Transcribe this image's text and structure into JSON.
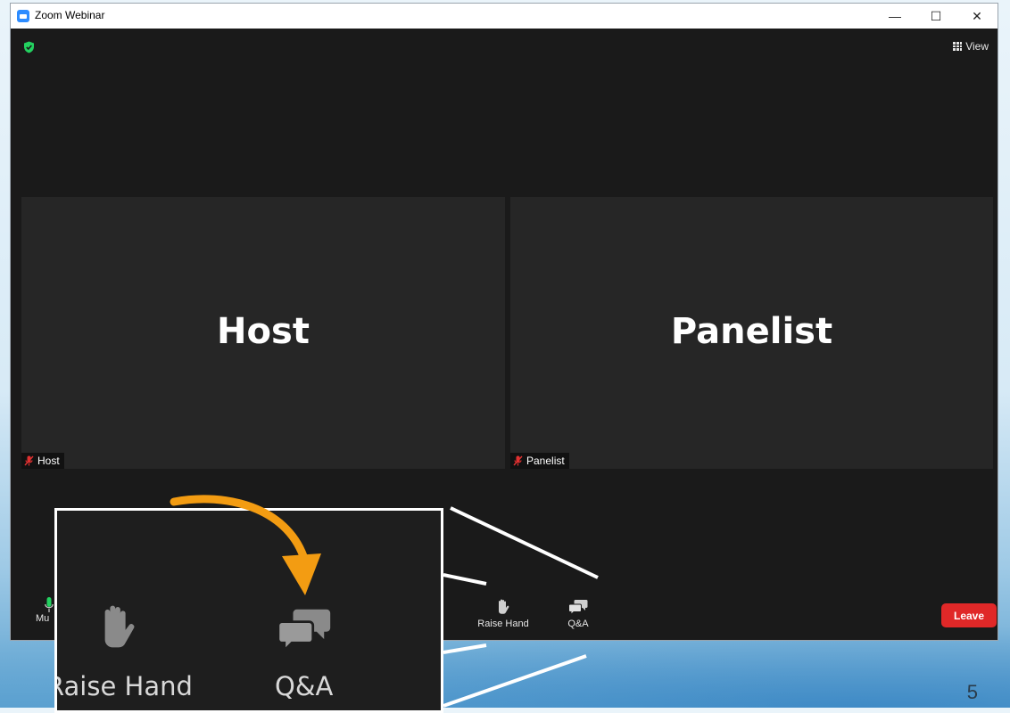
{
  "window": {
    "title": "Zoom Webinar",
    "minimize_glyph": "—",
    "maximize_glyph": "☐",
    "close_glyph": "✕"
  },
  "top_bar": {
    "view_label": "View",
    "security_icon": "shield-check-icon",
    "view_icon": "grid-icon"
  },
  "tiles": [
    {
      "display_name": "Host",
      "tag_label": "Host",
      "muted": true
    },
    {
      "display_name": "Panelist",
      "tag_label": "Panelist",
      "muted": true
    }
  ],
  "toolbar": {
    "mute_label": "Mu",
    "raise_hand_label": "Raise Hand",
    "qa_label": "Q&A",
    "leave_label": "Leave"
  },
  "zoom_callout": {
    "raise_hand_label": "Raise Hand",
    "qa_label": "Q&A",
    "arrow_color": "#f39c12"
  },
  "slide": {
    "page_number": "5"
  },
  "colors": {
    "window_bg": "#1a1a1a",
    "tile_bg": "#262626",
    "leave_red": "#e02828",
    "mic_green": "#23d160"
  }
}
